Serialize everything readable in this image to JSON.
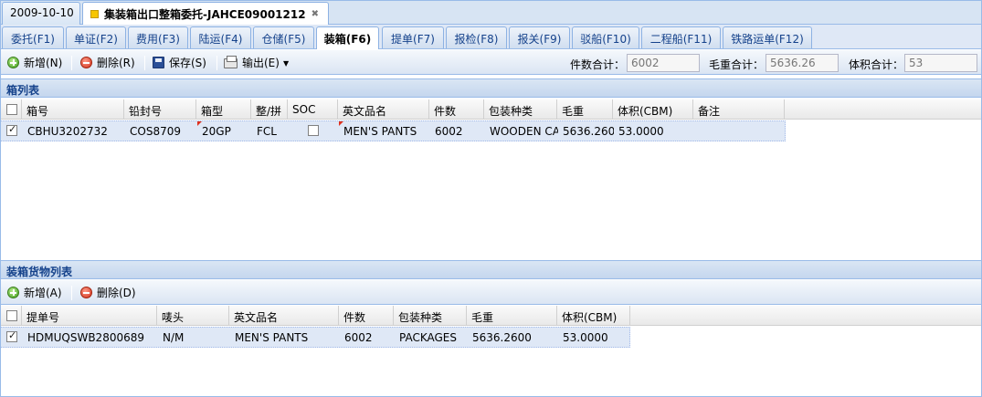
{
  "doc_tabs": [
    {
      "label": "2009-10-10"
    },
    {
      "label": "集装箱出口整箱委托-JAHCE09001212"
    }
  ],
  "fn_tabs": [
    {
      "label": "委托(F1)"
    },
    {
      "label": "单证(F2)"
    },
    {
      "label": "费用(F3)"
    },
    {
      "label": "陆运(F4)"
    },
    {
      "label": "仓储(F5)"
    },
    {
      "label": "装箱(F6)"
    },
    {
      "label": "提单(F7)"
    },
    {
      "label": "报检(F8)"
    },
    {
      "label": "报关(F9)"
    },
    {
      "label": "驳船(F10)"
    },
    {
      "label": "二程船(F11)"
    },
    {
      "label": "铁路运单(F12)"
    }
  ],
  "toolbar": {
    "add_label": "新增(N)",
    "delete_label": "删除(R)",
    "save_label": "保存(S)",
    "export_label": "输出(E)",
    "qty_total_label": "件数合计：",
    "qty_total_value": "6002",
    "weight_total_label": "毛重合计：",
    "weight_total_value": "5636.26",
    "volume_total_label": "体积合计：",
    "volume_total_value": "53"
  },
  "container_panel": {
    "title": "箱列表",
    "columns": [
      "箱号",
      "铅封号",
      "箱型",
      "整/拼",
      "SOC",
      "英文品名",
      "件数",
      "包装种类",
      "毛重",
      "体积(CBM)",
      "备注"
    ],
    "rows": [
      {
        "container_no": "CBHU3202732",
        "seal_no": "COS8709",
        "type": "20GP",
        "load": "FCL",
        "soc": "",
        "name_en": "MEN'S PANTS",
        "qty": "6002",
        "package": "WOODEN CA",
        "weight": "5636.260",
        "volume": "53.0000",
        "remark": ""
      }
    ]
  },
  "cargo_panel": {
    "title": "装箱货物列表",
    "add_label": "新增(A)",
    "delete_label": "删除(D)",
    "columns": [
      "提单号",
      "唛头",
      "英文品名",
      "件数",
      "包装种类",
      "毛重",
      "体积(CBM)"
    ],
    "rows": [
      {
        "bl_no": "HDMUQSWB2800689",
        "marks": "N/M",
        "name_en": "MEN'S PANTS",
        "qty": "6002",
        "package": "PACKAGES",
        "weight": "5636.2600",
        "volume": "53.0000"
      }
    ]
  }
}
